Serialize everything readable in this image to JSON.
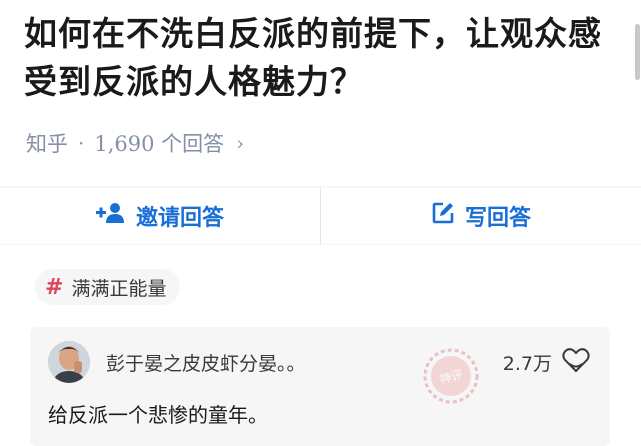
{
  "question": {
    "title": "如何在不洗白反派的前提下，让观众感受到反派的人格魅力？",
    "source": "知乎",
    "separator": "·",
    "answer_count": "1,690 个回答",
    "chevron": "›"
  },
  "actions": {
    "invite_label": "邀请回答",
    "invite_icon": "add-user-icon",
    "write_label": "写回答",
    "write_icon": "edit-icon",
    "accent_color": "#1a6fd6"
  },
  "tag": {
    "symbol": "#",
    "label": "满满正能量",
    "symbol_color": "#e0445a"
  },
  "answer": {
    "author": "彭于晏之皮皮虾分晏。。",
    "likes": "2.7万",
    "snippet": "给反派一个悲惨的童年。",
    "stamp_text": "神评"
  }
}
